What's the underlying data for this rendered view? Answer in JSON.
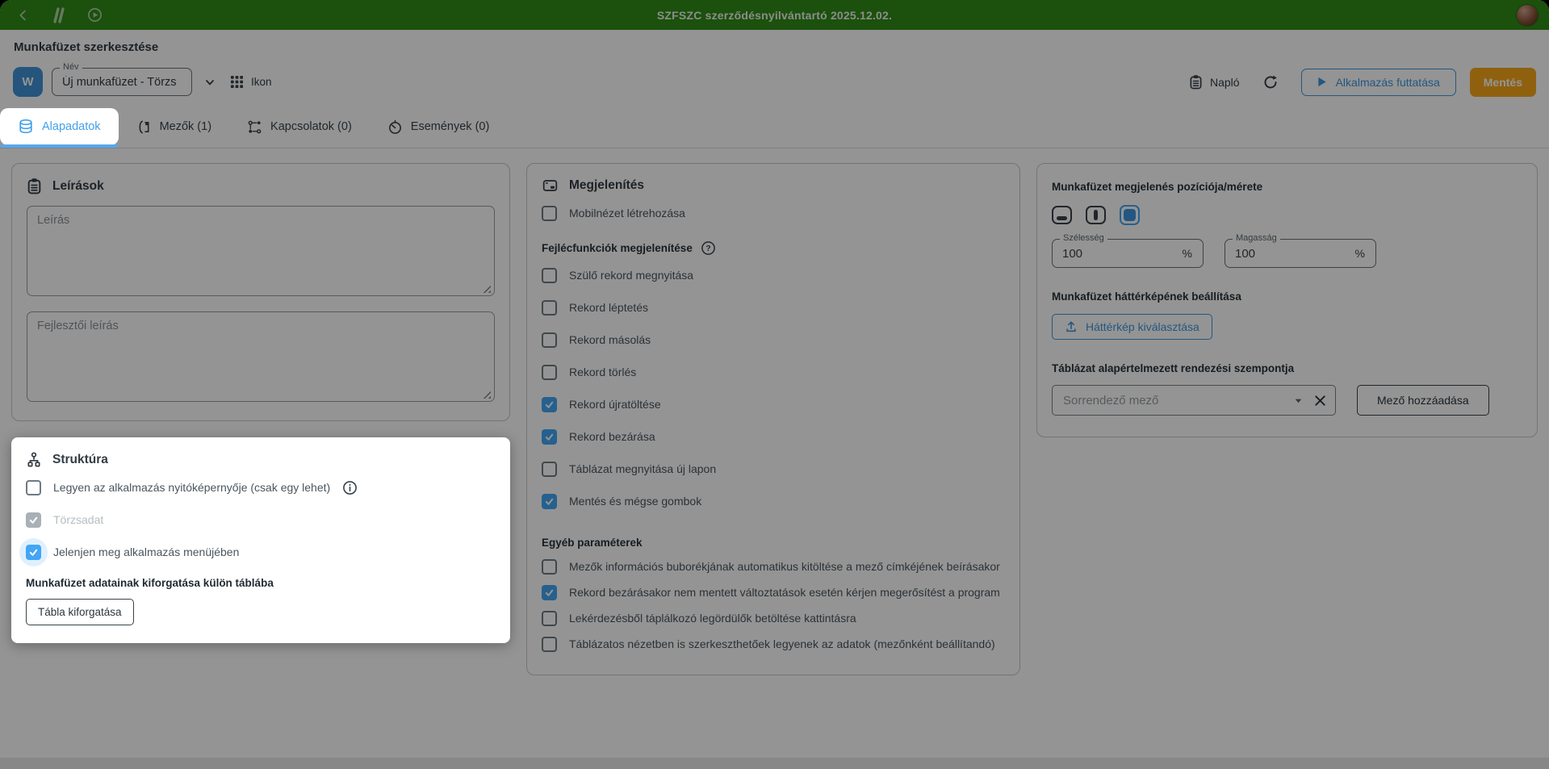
{
  "topbar": {
    "title": "SZFSZC szerződésnyilvántartó 2025.12.02."
  },
  "page": {
    "title": "Munkafüzet szerkesztése"
  },
  "toolbar": {
    "workbook_initial": "W",
    "name_label": "Név",
    "name_value": "Új munkafüzet - Törzs",
    "icon_label": "Ikon",
    "log_label": "Napló",
    "run_label": "Alkalmazás futtatása",
    "save_label": "Mentés"
  },
  "tabs": [
    {
      "label": "Alapadatok",
      "active": true
    },
    {
      "label": "Mezők (1)",
      "active": false
    },
    {
      "label": "Kapcsolatok (0)",
      "active": false
    },
    {
      "label": "Események (0)",
      "active": false
    }
  ],
  "descriptions": {
    "title": "Leírások",
    "description_placeholder": "Leírás",
    "developer_placeholder": "Fejlesztői leírás"
  },
  "structure": {
    "title": "Struktúra",
    "items": [
      {
        "label": "Legyen az alkalmazás nyitóképernyője (csak egy lehet)",
        "checked": false,
        "info": true
      },
      {
        "label": "Törzsadat",
        "checked": true,
        "disabled": true
      },
      {
        "label": "Jelenjen meg alkalmazás menüjében",
        "checked": true,
        "focused": true
      }
    ],
    "pivot_heading": "Munkafüzet adatainak kiforgatása külön táblába",
    "pivot_button": "Tábla kiforgatása"
  },
  "display": {
    "title": "Megjelenítés",
    "mobile": {
      "label": "Mobilnézet létrehozása",
      "checked": false
    },
    "header_heading": "Fejlécfunkciók megjelenítése",
    "header_items": [
      {
        "label": "Szülő rekord megnyitása",
        "checked": false
      },
      {
        "label": "Rekord léptetés",
        "checked": false
      },
      {
        "label": "Rekord másolás",
        "checked": false
      },
      {
        "label": "Rekord törlés",
        "checked": false
      },
      {
        "label": "Rekord újratöltése",
        "checked": true
      },
      {
        "label": "Rekord bezárása",
        "checked": true
      },
      {
        "label": "Táblázat megnyitása új lapon",
        "checked": false
      },
      {
        "label": "Mentés és mégse gombok",
        "checked": true
      }
    ],
    "other_heading": "Egyéb paraméterek",
    "other_items": [
      {
        "label": "Mezők információs buborékjának automatikus kitöltése a mező címkéjének beírásakor",
        "checked": false
      },
      {
        "label": "Rekord bezárásakor nem mentett változtatások esetén kérjen megerősítést a program",
        "checked": true
      },
      {
        "label": "Lekérdezésből táplálkozó legördülők betöltése kattintásra",
        "checked": false
      },
      {
        "label": "Táblázatos nézetben is szerkeszthetőek legyenek az adatok (mezőnként beállítandó)",
        "checked": false
      }
    ]
  },
  "appearance": {
    "position_heading": "Munkafüzet megjelenés pozíciója/mérete",
    "width_label": "Szélesség",
    "width_value": "100",
    "width_unit": "%",
    "height_label": "Magasság",
    "height_value": "100",
    "height_unit": "%",
    "background_heading": "Munkafüzet háttérképének beállítása",
    "background_button": "Háttérkép kiválasztása",
    "sort_heading": "Táblázat alapértelmezett rendezési szempontja",
    "sort_placeholder": "Sorrendező mező",
    "add_field_button": "Mező hozzáadása"
  },
  "colors": {
    "accent_blue": "#42A5F5",
    "brand_green": "#2F8A17",
    "save_amber": "#F7A81B"
  }
}
